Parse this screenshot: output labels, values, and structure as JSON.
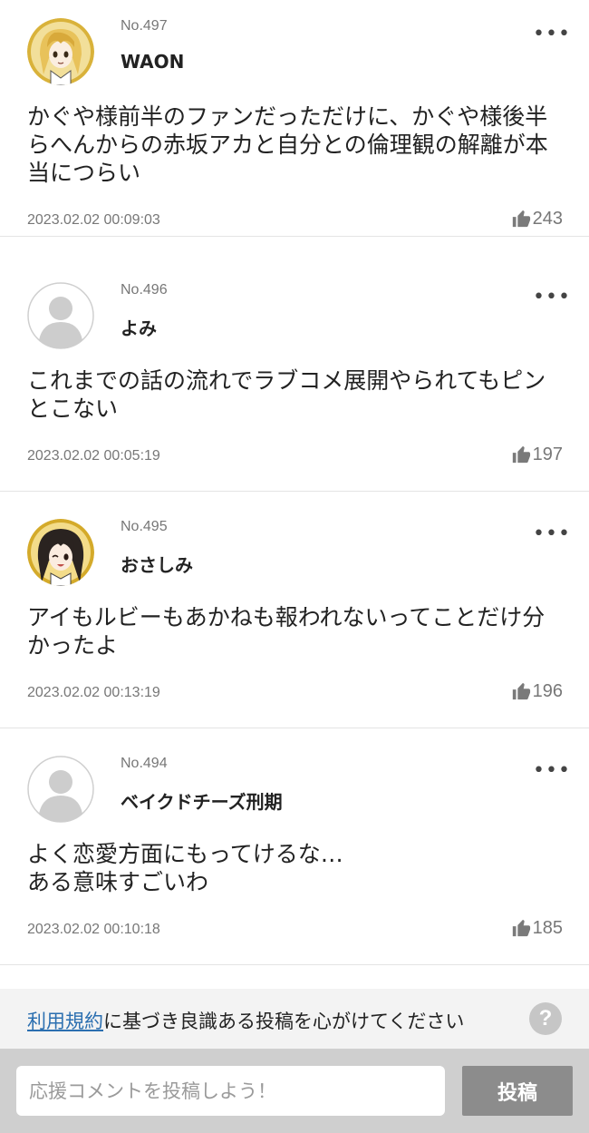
{
  "colors": {
    "link": "#2b6fb0",
    "post_button_bg": "#8c8c8c",
    "meta_text": "#777777",
    "notice_bg": "#f3f3f3"
  },
  "comments": [
    {
      "number": "No.497",
      "username": "WAON",
      "avatar": "anime-blonde-girl-avatar",
      "body": "かぐや様前半のファンだっただけに、かぐや様後半らへんからの赤坂アカと自分との倫理観の解離が本当につらい",
      "timestamp": "2023.02.02 00:09:03",
      "likes": "243"
    },
    {
      "number": "No.496",
      "username": "よみ",
      "avatar": "default-user-avatar",
      "body": "これまでの話の流れでラブコメ展開やられてもピンとこない",
      "timestamp": "2023.02.02 00:05:19",
      "likes": "197"
    },
    {
      "number": "No.495",
      "username": "おさしみ",
      "avatar": "anime-dark-hair-girl-avatar",
      "body": "アイもルビーもあかねも報われないってことだけ分かったよ",
      "timestamp": "2023.02.02 00:13:19",
      "likes": "196"
    },
    {
      "number": "No.494",
      "username": "ベイクドチーズ刑期",
      "avatar": "default-user-avatar",
      "body": "よく恋愛方面にもってけるな…\nある意味すごいわ",
      "timestamp": "2023.02.02 00:10:18",
      "likes": "185"
    }
  ],
  "notice": {
    "link_text": "利用規約",
    "text": "に基づき良識ある投稿を心がけてください",
    "help_icon_label": "?"
  },
  "compose": {
    "placeholder": "応援コメントを投稿しよう！",
    "value": "",
    "post_label": "投稿"
  }
}
